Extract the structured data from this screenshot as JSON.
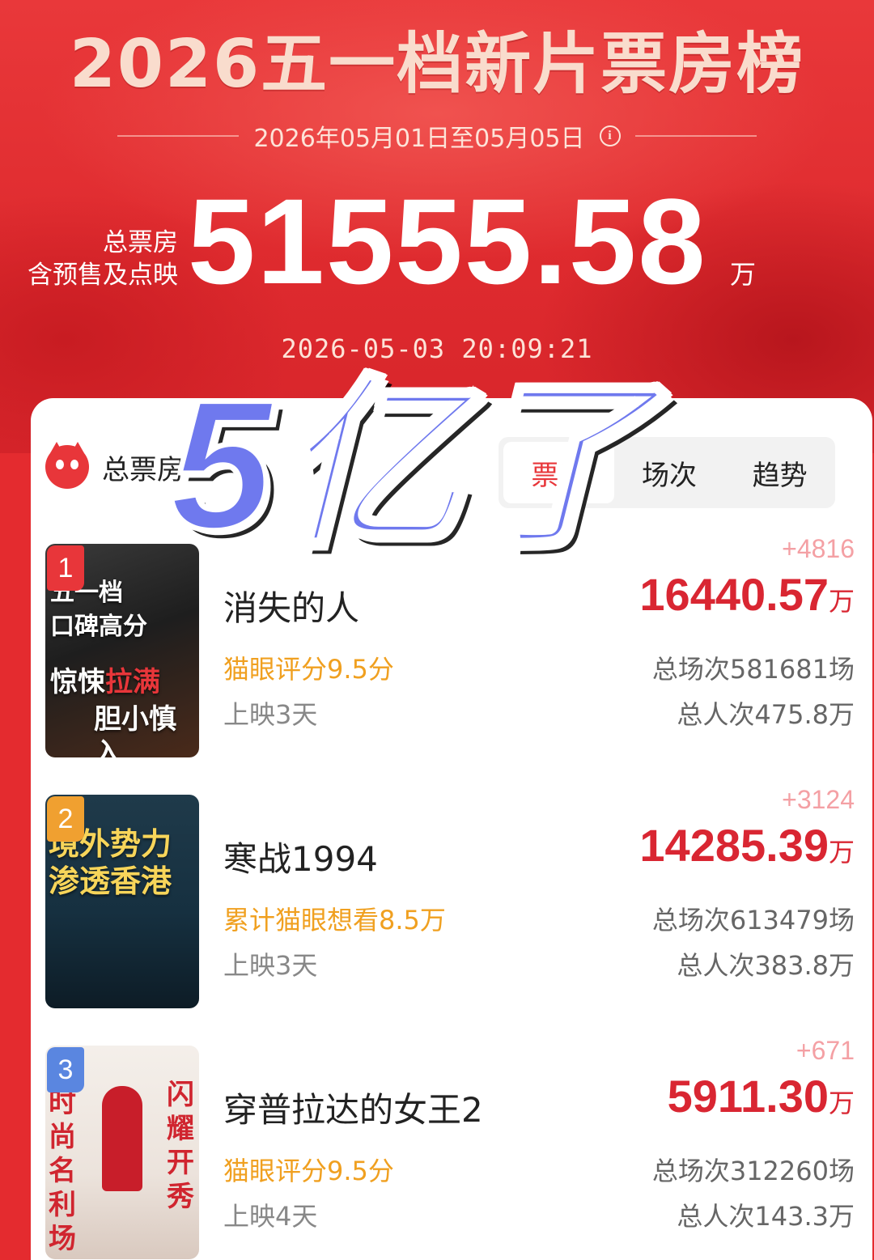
{
  "header": {
    "title": "2026五一档新片票房榜",
    "date_range": "2026年05月01日至05月05日",
    "total_label_1": "总票房",
    "total_label_2": "含预售及点映",
    "total_value": "51555.58",
    "total_unit": "万",
    "timestamp": "2026-05-03  20:09:21"
  },
  "overlay_text": "5亿了",
  "card": {
    "title": "总票房",
    "tabs": [
      "票房",
      "场次",
      "趋势"
    ],
    "active_tab": "票房"
  },
  "movies": [
    {
      "rank": "1",
      "rank_color": "#e8363a",
      "name": "消失的人",
      "sub": "猫眼评分9.5分",
      "days": "上映3天",
      "delta": "+4816",
      "gross": "16440.57",
      "unit": "万",
      "shows": "总场次581681场",
      "admissions": "总人次475.8万",
      "poster_text": "五一档口碑高分 惊悚拉满 胆小慎入"
    },
    {
      "rank": "2",
      "rank_color": "#f0a030",
      "name": "寒战1994",
      "sub": "累计猫眼想看8.5万",
      "days": "上映3天",
      "delta": "+3124",
      "gross": "14285.39",
      "unit": "万",
      "shows": "总场次613479场",
      "admissions": "总人次383.8万",
      "poster_text": "境外势力 渗透香港"
    },
    {
      "rank": "3",
      "rank_color": "#5a86e0",
      "name": "穿普拉达的女王2",
      "sub": "猫眼评分9.5分",
      "days": "上映4天",
      "delta": "+671",
      "gross": "5911.30",
      "unit": "万",
      "shows": "总场次312260场",
      "admissions": "总人次143.3万",
      "poster_text": "时尚名利场 闪耀开秀"
    }
  ]
}
